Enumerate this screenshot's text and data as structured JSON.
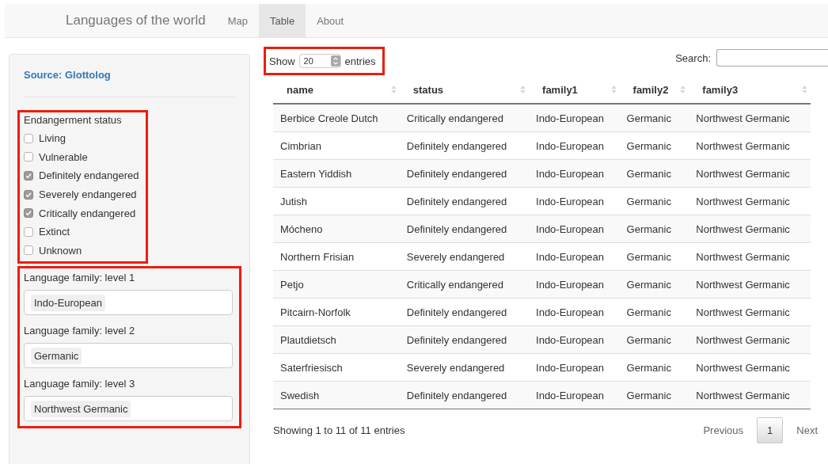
{
  "navbar": {
    "brand": "Languages of the world",
    "items": [
      {
        "label": "Map",
        "selected": false
      },
      {
        "label": "Table",
        "selected": true
      },
      {
        "label": "About",
        "selected": false
      }
    ]
  },
  "sidebar": {
    "source_link": "Source: Glottolog",
    "status_filter": {
      "label": "Endangerment status",
      "options": [
        {
          "label": "Living",
          "checked": false
        },
        {
          "label": "Vulnerable",
          "checked": false
        },
        {
          "label": "Definitely endangered",
          "checked": true
        },
        {
          "label": "Severely endangered",
          "checked": true
        },
        {
          "label": "Critically endangered",
          "checked": true
        },
        {
          "label": "Extinct",
          "checked": false
        },
        {
          "label": "Unknown",
          "checked": false
        }
      ]
    },
    "family_filters": [
      {
        "label": "Language family: level 1",
        "value": "Indo-European"
      },
      {
        "label": "Language family: level 2",
        "value": "Germanic"
      },
      {
        "label": "Language family: level 3",
        "value": "Northwest Germanic"
      }
    ]
  },
  "table_controls": {
    "show_label": "Show",
    "page_size": "20",
    "entries_label": "entries",
    "search_label": "Search:"
  },
  "table": {
    "columns": [
      "name",
      "status",
      "family1",
      "family2",
      "family3"
    ],
    "rows": [
      [
        "Berbice Creole Dutch",
        "Critically endangered",
        "Indo-European",
        "Germanic",
        "Northwest Germanic"
      ],
      [
        "Cimbrian",
        "Definitely endangered",
        "Indo-European",
        "Germanic",
        "Northwest Germanic"
      ],
      [
        "Eastern Yiddish",
        "Definitely endangered",
        "Indo-European",
        "Germanic",
        "Northwest Germanic"
      ],
      [
        "Jutish",
        "Definitely endangered",
        "Indo-European",
        "Germanic",
        "Northwest Germanic"
      ],
      [
        "Mócheno",
        "Definitely endangered",
        "Indo-European",
        "Germanic",
        "Northwest Germanic"
      ],
      [
        "Northern Frisian",
        "Severely endangered",
        "Indo-European",
        "Germanic",
        "Northwest Germanic"
      ],
      [
        "Petjo",
        "Critically endangered",
        "Indo-European",
        "Germanic",
        "Northwest Germanic"
      ],
      [
        "Pitcairn-Norfolk",
        "Definitely endangered",
        "Indo-European",
        "Germanic",
        "Northwest Germanic"
      ],
      [
        "Plautdietsch",
        "Definitely endangered",
        "Indo-European",
        "Germanic",
        "Northwest Germanic"
      ],
      [
        "Saterfriesisch",
        "Severely endangered",
        "Indo-European",
        "Germanic",
        "Northwest Germanic"
      ],
      [
        "Swedish",
        "Definitely endangered",
        "Indo-European",
        "Germanic",
        "Northwest Germanic"
      ]
    ]
  },
  "footer": {
    "info": "Showing 1 to 11 of 11 entries",
    "pagination": [
      {
        "label": "Previous",
        "selected": false
      },
      {
        "label": "1",
        "selected": true
      },
      {
        "label": "Next",
        "selected": false
      }
    ]
  }
}
